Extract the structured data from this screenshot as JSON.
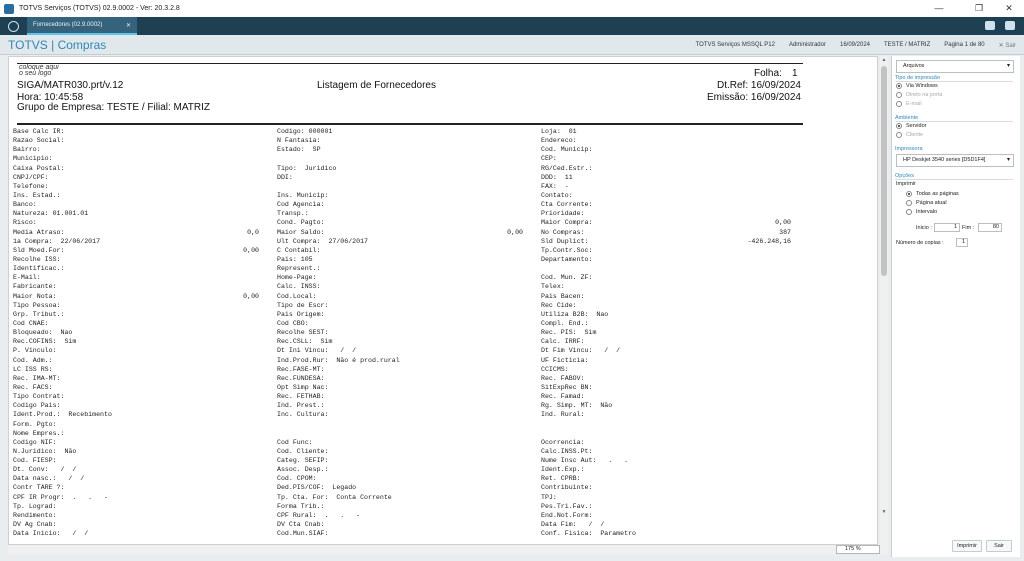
{
  "window": {
    "title": "TOTVS Serviços (TOTVS) 02.9.0002 - Ver: 20.3.2.8",
    "minimize": "—",
    "restore": "❐",
    "close": "✕"
  },
  "tabs": [
    {
      "label": "Fornecedores (02.9.0002)",
      "close": "✕"
    }
  ],
  "header": {
    "brand": "TOTVS | Compras",
    "environment": "TOTVS Serviços MSSQL P12",
    "user": "Administrador",
    "date": "16/09/2024",
    "branch": "TESTE / MATRIZ",
    "pages": "Pagina 1 de 80",
    "exit": "✕ Sair"
  },
  "report": {
    "logo_line1": "coloque aqui",
    "logo_line2": "o seu logo",
    "program": "SIGA/MATR030.prt/v.12",
    "title": "Listagem de Fornecedores",
    "page_label": "Folha:",
    "page_no": "1",
    "time": "Hora: 10:45:58",
    "dtref": "Dt.Ref: 16/09/2024",
    "group": "Grupo de Empresa: TESTE / Filial: MATRIZ",
    "emission": "Emissão: 16/09/2024",
    "col1": [
      "Base Calc IR:",
      "Razao Social:",
      "Bairro:",
      "Municipio:",
      "Caixa Postal:",
      "CNPJ/CPF:",
      "Telefone:",
      "Ins. Estad.:",
      "Banco:",
      "Natureza: 01.001.01",
      "Risco:",
      "Media Atraso:",
      "1a Compra:  22/06/2017",
      "Sld Moed.For:",
      "Recolhe ISS:",
      "Identificac.:",
      "E-Mail:",
      "Fabricante:",
      "Maior Nota:",
      "Tipo Pessoa:",
      "Grp. Tribut.:",
      "Cod CNAE:",
      "Bloqueado:  Nao",
      "Rec.COFINS:  Sim",
      "P. Vinculo:",
      "Cod. Adm.:",
      "LC ISS RS:",
      "Rec. IMA-MT:",
      "Rec. FACS:",
      "Tipo Contrat:",
      "Codigo Pais:",
      "Ident.Prod.:  Recebimento",
      "Form. Pgto:",
      "Nome Empres.:",
      "Codigo NIF:",
      "N.Juridico:  Não",
      "Cod. FIESP:",
      "Dt. Conv:   /  /",
      "Data nasc.:   /  /",
      "Contr TARE ?:",
      "CPF IR Progr:  .   .   -",
      "Tp. Lograd:",
      "Rendimento:",
      "DV Ag Cnab:",
      "Data Inicio:   /  /"
    ],
    "col1_values": {
      "11": "0,0",
      "13": "0,00",
      "18": "0,00"
    },
    "col2": [
      "Codigo: 000001",
      "N Fantasia:",
      "Estado:  SP",
      "",
      "Tipo:  Juridico",
      "DDI:",
      "",
      "Ins. Municip:",
      "Cod Agencia:",
      "Transp.:",
      "Cond. Pagto:",
      "Maior Saldo:",
      "Ult Compra:  27/06/2017",
      "C Contabil:",
      "Pais: 105",
      "Represent.:",
      "Home-Page:",
      "Calc. INSS:",
      "Cod.Local:",
      "Tipo de Escr:",
      "Pais Origem:",
      "Cod CBO:",
      "Recolhe SEST:",
      "Rec.CSLL:  Sim",
      "Dt Ini Vincu:   /  /",
      "Ind.Prod.Rur:  Não é prod.rural",
      "Rec.FASE-MT:",
      "Rec.FUNDESA:",
      "Opt Simp Nac:",
      "Rec. FETHAB:",
      "Ind. Prest.:",
      "Inc. Cultura:",
      "",
      "",
      "Cod Func:",
      "Cod. Cliente:",
      "Categ. SEFIP:",
      "Assoc. Desp.:",
      "Cod. CPOM:",
      "Ded.PIS/COF:  Legado",
      "Tp. Cta. For:  Conta Corrente",
      "Forma Trib.:",
      "CPF Rural:  .   .   -",
      "DV Cta Cnab:",
      "Cod.Mun.SIAF:"
    ],
    "col2_values": {
      "11": "0,00"
    },
    "col3": [
      "Loja:  01",
      "Endereco:",
      "Cod. Municip:",
      "CEP:",
      "RG/Ced.Estr.:",
      "DDD:  11",
      "FAX:  -",
      "Contato:",
      "Cta Corrente:",
      "Prioridade:",
      "Maior Compra:",
      "No Compras:",
      "Sld Duplict:",
      "Tp.Contr.Soc:",
      "Departamento:",
      "",
      "Cod. Mun. ZF:",
      "Telex:",
      "Pais Bacen:",
      "Rec Cide:",
      "Utiliza B2B:  Nao",
      "Compl. End.:",
      "Rec. PIS:  Sim",
      "Calc. IRRF:",
      "Dt Fim Vincu:   /  /",
      "UF Ficticia:",
      "CCICMS:",
      "Rec. FABOV:",
      "SitExpRec BN:",
      "Rec. Famad:",
      "Rg. Simp. MT:  Não",
      "Ind. Rural:",
      "",
      "",
      "Ocorrencia:",
      "Calc.INSS.Pt:",
      "Nume Insc Aut:   .   .",
      "Ident.Exp.:",
      "Ret. CPRB:",
      "Contribuinte:",
      "TPJ:",
      "Pes.Tri.Fav.:",
      "End.Not.Form:",
      "Data Fim:   /  /",
      "Conf. Fisica:  Parametro"
    ],
    "col3_values": {
      "10": "0,00",
      "11": "387",
      "12": "-426.248,16"
    }
  },
  "viewer": {
    "zoom": "175 %"
  },
  "sidebar": {
    "output": "Arquivos",
    "print_type_label": "Tipo de impressão",
    "print_type_options": [
      "Via Windows",
      "Direto na porta",
      "E-mail"
    ],
    "environment_label": "Ambiente",
    "environment_options": [
      "Servidor",
      "Cliente"
    ],
    "printer_label": "Impressora",
    "printer": "HP Deskjet 3540 series [D5D1F4]",
    "options_label": "Opções",
    "print_label": "Imprimir",
    "print_options": [
      "Todas as páginas",
      "Página atual",
      "Intervalo"
    ],
    "start_label": "Inicio :",
    "start_value": "1",
    "end_label": "Fim :",
    "end_value": "80",
    "copies_label": "Número de copias :",
    "copies_value": "1",
    "print_button": "Imprimir",
    "exit_button": "Sair"
  },
  "colors": {
    "tabbar": "#1f3f52",
    "accent": "#2f87b7",
    "tab_active": "#35637c"
  }
}
